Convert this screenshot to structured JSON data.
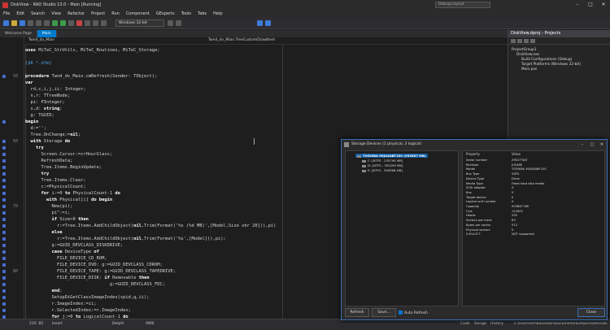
{
  "title_bar": {
    "title": "DiskView - RAD Studio 13.0 - Main [Running]",
    "search": "Debug Layout"
  },
  "menu": [
    "File",
    "Edit",
    "Search",
    "View",
    "Refactor",
    "Project",
    "Run",
    "Component",
    "GExperts",
    "Tools",
    "Tabs",
    "Help"
  ],
  "toolbar": {
    "platform": "Windows 32-bit"
  },
  "tabs": [
    {
      "label": "Welcome Page"
    },
    {
      "label": "Main"
    }
  ],
  "editor": {
    "breadcrumb_left": "Twnd_dv_Main",
    "breadcrumb_right": "Twnd_dv_Main.TreeCustomDrawItem",
    "lines": [
      {
        "n": "",
        "t": "uses MiTeC_StrUtils, MiTeC_Routines, MiTeC_Storage;"
      },
      {
        "n": "",
        "t": ""
      },
      {
        "n": "",
        "t": "{$R *.dfm}"
      },
      {
        "n": "",
        "t": ""
      },
      {
        "n": "50",
        "t": "procedure Twnd_dv_Main.cmRefresh(Sender: TObject);"
      },
      {
        "n": "",
        "t": "var"
      },
      {
        "n": "",
        "t": "  rd,c,i,j,ii: Integer;"
      },
      {
        "n": "",
        "t": "  n,r: TTreeNode;"
      },
      {
        "n": "",
        "t": "  pi: PInteger;"
      },
      {
        "n": "",
        "t": "  s,d: string;"
      },
      {
        "n": "",
        "t": "  g: TGUID;"
      },
      {
        "n": "",
        "t": "begin"
      },
      {
        "n": "",
        "t": "  d:='';"
      },
      {
        "n": "",
        "t": "  Tree.OnChange:=nil;"
      },
      {
        "n": "60",
        "t": "  with Storage do"
      },
      {
        "n": "",
        "t": "    try"
      },
      {
        "n": "",
        "t": "      Screen.Cursor:=crHourGlass;"
      },
      {
        "n": "",
        "t": "      RefreshData;"
      },
      {
        "n": "",
        "t": "      Tree.Items.BeginUpdate;"
      },
      {
        "n": "",
        "t": "      try"
      },
      {
        "n": "",
        "t": "      Tree.Items.Clear;"
      },
      {
        "n": "",
        "t": "      c:=PhysicalCount;"
      },
      {
        "n": "",
        "t": "      for i:=0 to PhysicalCount-1 do"
      },
      {
        "n": "",
        "t": "        with Physical[i] do begin"
      },
      {
        "n": "70",
        "t": "          New(pi);"
      },
      {
        "n": "",
        "t": "          pi^:=i;"
      },
      {
        "n": "",
        "t": "          if Size>0 then"
      },
      {
        "n": "",
        "t": "            r:=Tree.Items.AddChildObject(nil,Trim(Format('%s (%d MB)',[Model,Size shr 20])),pi)"
      },
      {
        "n": "",
        "t": "          else"
      },
      {
        "n": "",
        "t": "            r:=Tree.Items.AddChildObject(nil,Trim(Format('%s',[Model])),pi);"
      },
      {
        "n": "",
        "t": "          g:=GUID_DEVCLASS_DISKDRIVE;"
      },
      {
        "n": "",
        "t": "          case DeviceType of"
      },
      {
        "n": "",
        "t": "            FILE_DEVICE_CD_ROM,"
      },
      {
        "n": "",
        "t": "            FILE_DEVICE_DVD: g:=GUID_DEVCLASS_CDROM;"
      },
      {
        "n": "80",
        "t": "            FILE_DEVICE_TAPE: g:=GUID_DEVCLASS_TAPEDRIVE;"
      },
      {
        "n": "",
        "t": "            FILE_DEVICE_DISK: if Removable then"
      },
      {
        "n": "",
        "t": "                                g:=GUID_DEVCLASS_FDC;"
      },
      {
        "n": "",
        "t": "          end;"
      },
      {
        "n": "",
        "t": "          SetupDiGetClassImageIndex(spid,g,ii);"
      },
      {
        "n": "",
        "t": "          r.ImageIndex:=ii;"
      },
      {
        "n": "",
        "t": "          r.SelectedIndex:=r.ImageIndex;"
      },
      {
        "n": "",
        "t": "          for j:=0 to LogicalCount-1 do"
      }
    ]
  },
  "projects": {
    "title": "DiskView.dproj - Projects",
    "items": [
      {
        "label": "ProjectGroup1",
        "indent": 0
      },
      {
        "label": "DiskView.exe",
        "indent": 1
      },
      {
        "label": "Build Configurations (Debug)",
        "indent": 2
      },
      {
        "label": "Target Platforms (Windows 32-bit)",
        "indent": 2
      },
      {
        "label": "Main.pas",
        "indent": 2
      }
    ]
  },
  "status": {
    "pos": "235: 82",
    "mode": "Insert",
    "lang": "Delphi",
    "enc": "ANSI",
    "tabs": [
      "Code",
      "Design",
      "History"
    ],
    "path": "C:\\Users\\Ambassador\\Documents\\Embarcadero\\Studio\\23..."
  },
  "dialog": {
    "title": "Storage Devices (1 physical, 3 logical)",
    "tree": [
      {
        "label": "TOSHIBA MQ04ABF100 (953867 MB)",
        "selected": true,
        "indent": 0
      },
      {
        "label": "C: [NTFS - 235790 MB]",
        "indent": 1
      },
      {
        "label": "D: [NTFS - 350299 MB]",
        "indent": 1
      },
      {
        "label": "E: [NTFS - 358368 MB]",
        "indent": 1
      }
    ],
    "prop_header": {
      "key": "Property",
      "value": "Value"
    },
    "props": [
      [
        "Serial number",
        "Z9S27TJAT"
      ],
      [
        "Revision",
        "JU048E"
      ],
      [
        "Model",
        "TOSHIBA MQ04ABF100"
      ],
      [
        "Bus Type",
        "SATA"
      ],
      [
        "Device Type",
        "Drive"
      ],
      [
        "Media Type",
        "Fixed hard disk media"
      ],
      [
        "SCSI adapter",
        "0"
      ],
      [
        "Bus",
        "0"
      ],
      [
        "Target device",
        "0"
      ],
      [
        "Logical unit number",
        "0"
      ],
      [
        "Capacity",
        "953867 MB"
      ],
      [
        "Cyls",
        "121601"
      ],
      [
        "Heads",
        "255"
      ],
      [
        "Sectors per track",
        "63"
      ],
      [
        "Bytes per sector",
        "512"
      ],
      [
        "Physical sectors",
        "0"
      ],
      [
        "S.M.A.R.T.",
        "NOT supported"
      ]
    ],
    "buttons": {
      "refresh": "Refresh",
      "save": "Save...",
      "close": "Close"
    },
    "auto_refresh": "Auto Refresh"
  }
}
